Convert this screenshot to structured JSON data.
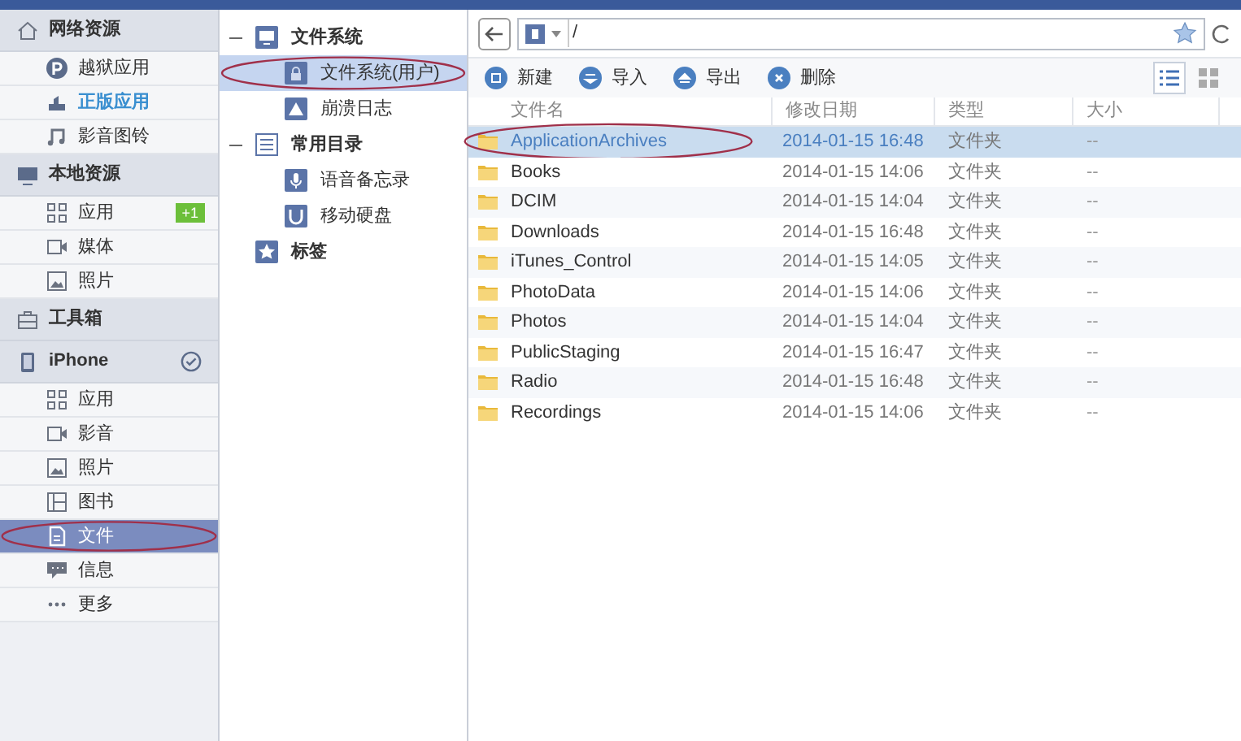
{
  "sidebar": {
    "sections": [
      {
        "title": "网络资源",
        "items": [
          {
            "label": "越狱应用",
            "highlighted": false,
            "selected": false,
            "circled": false
          },
          {
            "label": "正版应用",
            "highlighted": true,
            "selected": false,
            "circled": false
          },
          {
            "label": "影音图铃",
            "highlighted": false,
            "selected": false,
            "circled": false
          }
        ]
      },
      {
        "title": "本地资源",
        "items": [
          {
            "label": "应用",
            "badge": "+1",
            "highlighted": false,
            "selected": false,
            "circled": false
          },
          {
            "label": "媒体",
            "highlighted": false,
            "selected": false,
            "circled": false
          },
          {
            "label": "照片",
            "highlighted": false,
            "selected": false,
            "circled": false
          }
        ]
      },
      {
        "title": "工具箱"
      },
      {
        "title": "iPhone",
        "connected": true,
        "items": [
          {
            "label": "应用",
            "highlighted": false,
            "selected": false,
            "circled": false
          },
          {
            "label": "影音",
            "highlighted": false,
            "selected": false,
            "circled": false
          },
          {
            "label": "照片",
            "highlighted": false,
            "selected": false,
            "circled": false
          },
          {
            "label": "图书",
            "highlighted": false,
            "selected": false,
            "circled": false
          },
          {
            "label": "文件",
            "highlighted": false,
            "selected": true,
            "circled": true
          },
          {
            "label": "信息",
            "highlighted": false,
            "selected": false,
            "circled": false
          },
          {
            "label": "更多",
            "highlighted": false,
            "selected": false,
            "circled": false
          }
        ]
      }
    ]
  },
  "tree": [
    {
      "label": "文件系统",
      "expanded": true,
      "children": [
        {
          "label": "文件系统(用户)",
          "selected": true,
          "circled": true
        },
        {
          "label": "崩溃日志",
          "selected": false,
          "circled": false
        }
      ]
    },
    {
      "label": "常用目录",
      "expanded": true,
      "children": [
        {
          "label": "语音备忘录",
          "selected": false,
          "circled": false
        },
        {
          "label": "移动硬盘",
          "selected": false,
          "circled": false
        }
      ]
    },
    {
      "label": "标签"
    }
  ],
  "address_bar": {
    "path": "/"
  },
  "toolbar": [
    {
      "label": "新建"
    },
    {
      "label": "导入"
    },
    {
      "label": "导出"
    },
    {
      "label": "删除"
    }
  ],
  "view_modes": [
    {
      "kind": "list",
      "selected": true
    },
    {
      "kind": "grid",
      "selected": false
    }
  ],
  "table": {
    "columns": [
      "文件名",
      "修改日期",
      "类型",
      "大小"
    ],
    "rows": [
      {
        "name": "ApplicationArchives",
        "date": "2014-01-15 16:48",
        "type": "文件夹",
        "size": "--",
        "selected": true,
        "circled": true
      },
      {
        "name": "Books",
        "date": "2014-01-15 14:06",
        "type": "文件夹",
        "size": "--",
        "selected": false,
        "circled": false
      },
      {
        "name": "DCIM",
        "date": "2014-01-15 14:04",
        "type": "文件夹",
        "size": "--",
        "selected": false,
        "circled": false
      },
      {
        "name": "Downloads",
        "date": "2014-01-15 16:48",
        "type": "文件夹",
        "size": "--",
        "selected": false,
        "circled": false
      },
      {
        "name": "iTunes_Control",
        "date": "2014-01-15 14:05",
        "type": "文件夹",
        "size": "--",
        "selected": false,
        "circled": false
      },
      {
        "name": "PhotoData",
        "date": "2014-01-15 14:06",
        "type": "文件夹",
        "size": "--",
        "selected": false,
        "circled": false
      },
      {
        "name": "Photos",
        "date": "2014-01-15 14:04",
        "type": "文件夹",
        "size": "--",
        "selected": false,
        "circled": false
      },
      {
        "name": "PublicStaging",
        "date": "2014-01-15 16:47",
        "type": "文件夹",
        "size": "--",
        "selected": false,
        "circled": false
      },
      {
        "name": "Radio",
        "date": "2014-01-15 16:48",
        "type": "文件夹",
        "size": "--",
        "selected": false,
        "circled": false
      },
      {
        "name": "Recordings",
        "date": "2014-01-15 14:06",
        "type": "文件夹",
        "size": "--",
        "selected": false,
        "circled": false
      }
    ]
  }
}
